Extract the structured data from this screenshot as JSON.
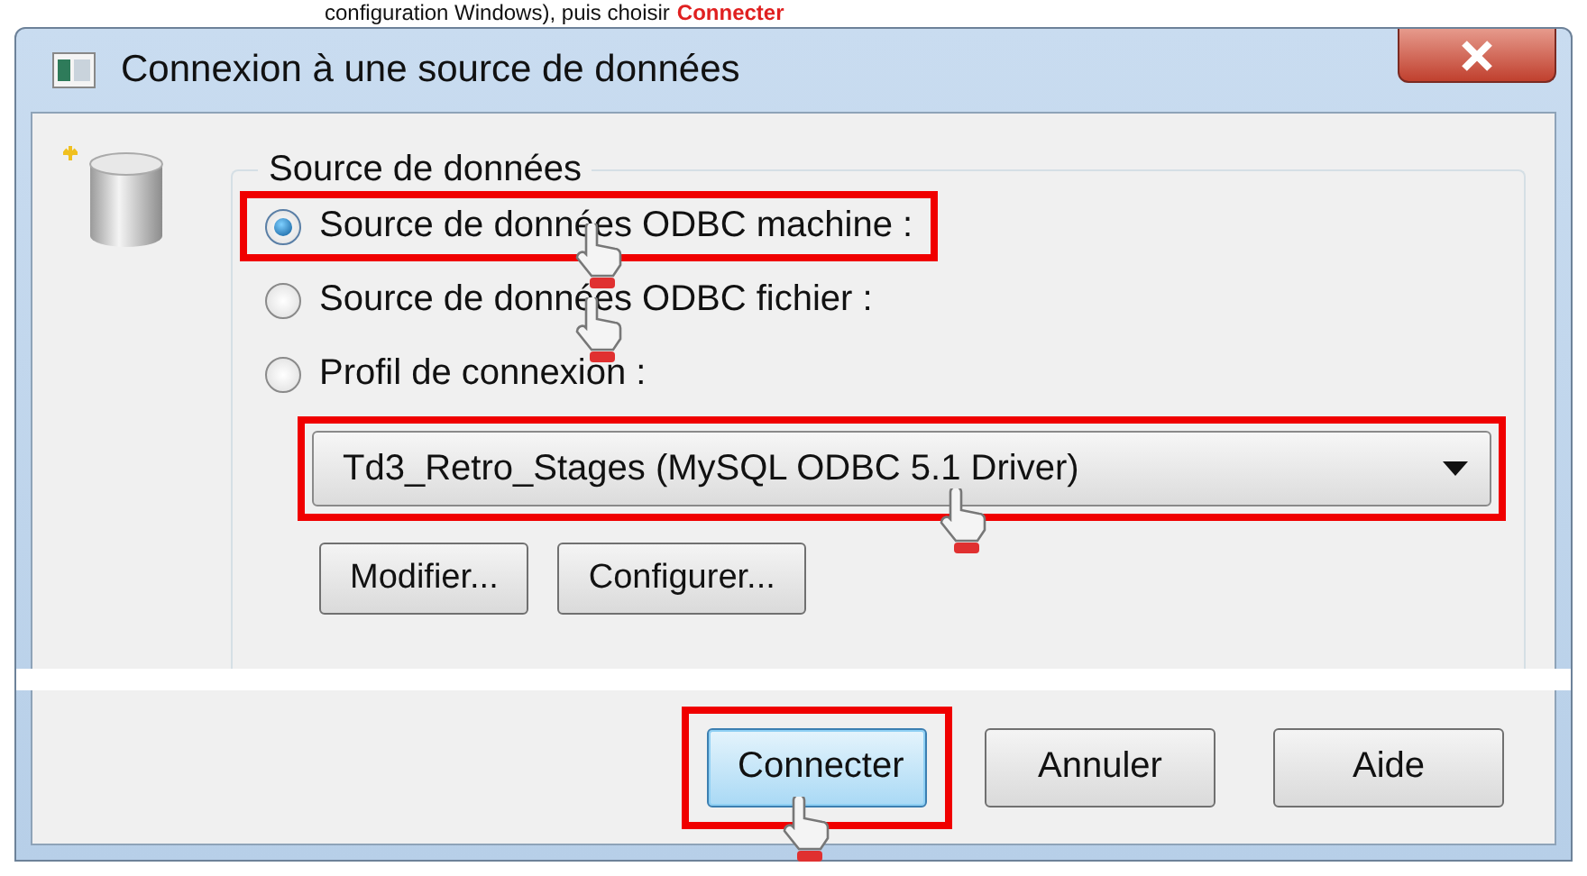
{
  "caption": {
    "text": "configuration Windows), puis choisir",
    "highlight": "Connecter"
  },
  "window": {
    "title": "Connexion à une source de données"
  },
  "group": {
    "title": "Source de données"
  },
  "options": [
    {
      "label": "Source de données ODBC machine :",
      "selected": true,
      "highlighted": true,
      "cursor": true
    },
    {
      "label": "Source de données ODBC fichier :",
      "selected": false,
      "highlighted": false,
      "cursor": true
    },
    {
      "label": "Profil de connexion :",
      "selected": false,
      "highlighted": false,
      "cursor": false
    }
  ],
  "profile": {
    "value": "Td3_Retro_Stages (MySQL ODBC 5.1 Driver)",
    "highlighted": true,
    "cursor": true
  },
  "profile_buttons": [
    "Modifier...",
    "Configurer..."
  ],
  "buttons": [
    {
      "label": "Connecter",
      "default": true,
      "highlighted": true,
      "cursor": true
    },
    {
      "label": "Annuler",
      "default": false,
      "highlighted": false,
      "cursor": false
    },
    {
      "label": "Aide",
      "default": false,
      "highlighted": false,
      "cursor": false
    }
  ]
}
